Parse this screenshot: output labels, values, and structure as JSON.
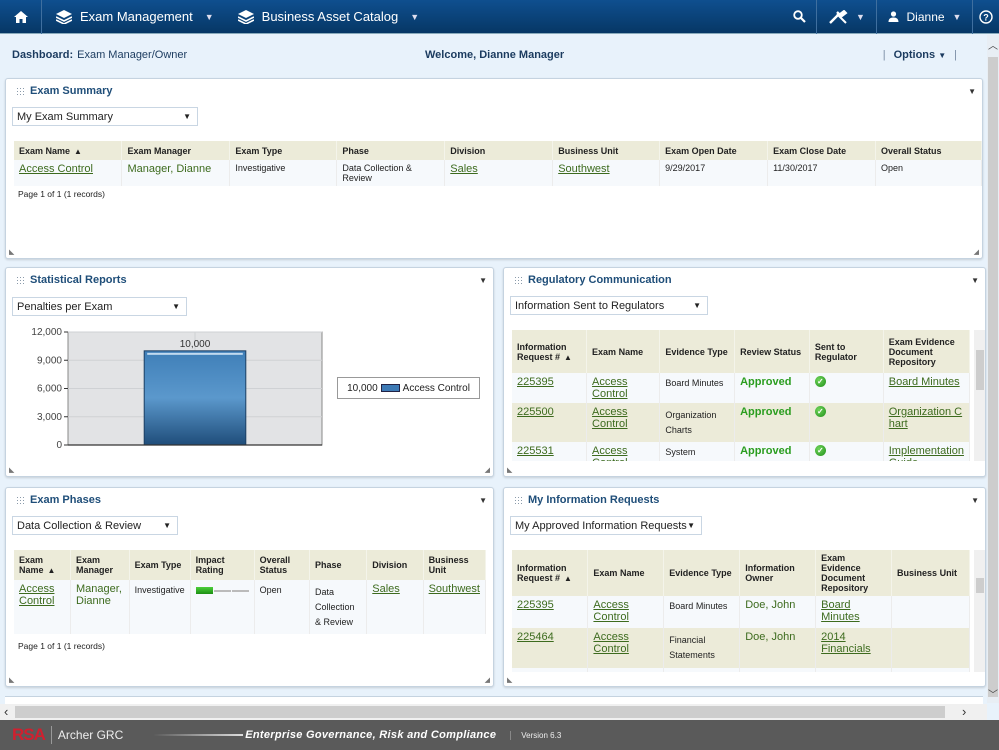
{
  "topnav": {
    "home_icon": "home-icon",
    "menus": [
      {
        "label": "Exam Management",
        "icon": "layers-icon"
      },
      {
        "label": "Business Asset Catalog",
        "icon": "layers-icon"
      }
    ],
    "search_icon": "search-icon",
    "tools_icon": "tools-icon",
    "user_name": "Dianne",
    "help_icon": "help-icon"
  },
  "subhead": {
    "dashboard_label": "Dashboard:",
    "dashboard_value": "Exam Manager/Owner",
    "welcome": "Welcome, Dianne Manager",
    "options_label": "Options"
  },
  "exam_summary": {
    "title": "Exam Summary",
    "view": "My Exam Summary",
    "columns": [
      "Exam Name",
      "Exam Manager",
      "Exam Type",
      "Phase",
      "Division",
      "Business Unit",
      "Exam Open Date",
      "Exam Close Date",
      "Overall Status"
    ],
    "rows": [
      {
        "exam_name": "Access Control",
        "exam_manager": "Manager, Dianne",
        "exam_type": "Investigative",
        "phase": "Data Collection & Review",
        "division": "Sales",
        "business_unit": "Southwest",
        "open_date": "9/29/2017",
        "close_date": "11/30/2017",
        "status": "Open"
      }
    ],
    "pager": "Page 1 of 1 (1 records)"
  },
  "statistical_reports": {
    "title": "Statistical Reports",
    "view": "Penalties per Exam",
    "legend_value": "10,000",
    "legend_label": "Access Control"
  },
  "chart_data": {
    "type": "bar",
    "title": "Penalties per Exam",
    "categories": [
      "Access Control"
    ],
    "values": [
      10000
    ],
    "data_labels": [
      "10,000"
    ],
    "xlabel": "",
    "ylabel": "",
    "ylim": [
      0,
      12000
    ],
    "yticks": [
      0,
      3000,
      6000,
      9000,
      12000
    ],
    "ytick_labels": [
      "0",
      "3,000",
      "6,000",
      "9,000",
      "12,000"
    ],
    "grid": true,
    "legend": "right",
    "color": "#3d7ab5"
  },
  "regulatory_communication": {
    "title": "Regulatory Communication",
    "view": "Information Sent to Regulators",
    "columns": [
      "Information Request #",
      "Exam Name",
      "Evidence Type",
      "Review Status",
      "Sent to Regulator",
      "Exam Evidence Document Repository"
    ],
    "rows": [
      {
        "request": "225395",
        "exam_name": "Access Control",
        "evidence_type": "Board Minutes",
        "review_status": "Approved",
        "sent": true,
        "repository": "Board Minutes"
      },
      {
        "request": "225500",
        "exam_name": "Access Control",
        "evidence_type": "Organization Charts",
        "review_status": "Approved",
        "sent": true,
        "repository": "Organization Chart"
      },
      {
        "request": "225531",
        "exam_name": "Access Control",
        "evidence_type": "System",
        "review_status": "Approved",
        "sent": true,
        "repository": "Implementation Guide"
      }
    ]
  },
  "exam_phases": {
    "title": "Exam Phases",
    "view": "Data Collection & Review",
    "columns": [
      "Exam Name",
      "Exam Manager",
      "Exam Type",
      "Impact Rating",
      "Overall Status",
      "Phase",
      "Division",
      "Business Unit"
    ],
    "rows": [
      {
        "exam_name": "Access Control",
        "exam_manager": "Manager, Dianne",
        "exam_type": "Investigative",
        "impact_rating": 1,
        "impact_max": 3,
        "status": "Open",
        "phase": "Data Collection & Review",
        "division": "Sales",
        "business_unit": "Southwest"
      }
    ],
    "pager": "Page 1 of 1 (1 records)"
  },
  "my_information_requests": {
    "title": "My Information Requests",
    "view": "My Approved Information Requests",
    "columns": [
      "Information Request #",
      "Exam Name",
      "Evidence Type",
      "Information Owner",
      "Exam Evidence Document Repository",
      "Business Unit"
    ],
    "rows": [
      {
        "request": "225395",
        "exam_name": "Access Control",
        "evidence_type": "Board Minutes",
        "owner": "Doe, John",
        "repository": "Board Minutes",
        "business_unit": ""
      },
      {
        "request": "225464",
        "exam_name": "Access Control",
        "evidence_type": "Financial Statements",
        "owner": "Doe, John",
        "repository": "2014 Financials",
        "business_unit": ""
      }
    ]
  },
  "footer": {
    "brand": "RSA",
    "product": "Archer GRC",
    "tagline": "Enterprise Governance, Risk and Compliance",
    "version": "Version 6.3"
  }
}
